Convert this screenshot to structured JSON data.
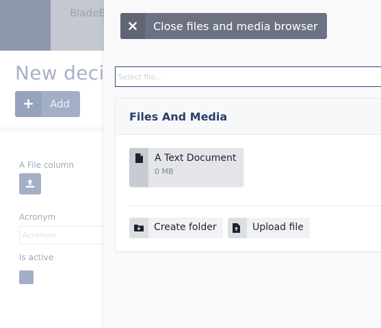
{
  "background_page": {
    "app_name": "BladeB",
    "title": "New deci",
    "add_button_label": "Add",
    "fields": {
      "file_column_label": "A File column",
      "acronym_label": "Acronym",
      "acronym_placeholder": "Acronym",
      "is_active_label": "Is active"
    }
  },
  "overlay": {
    "close_button_label": "Close files and media browser",
    "select_placeholder": "Select file...",
    "card_title": "Files And Media",
    "files": [
      {
        "name": "A Text Document",
        "size": "0 MB"
      }
    ],
    "actions": {
      "create_folder_label": "Create folder",
      "upload_file_label": "Upload file"
    }
  },
  "colors": {
    "accent": "#6c7281",
    "title_blue": "#2a3f6a",
    "muted_button": "#a3afc6"
  },
  "icons": {
    "close": "close-icon",
    "file": "file-icon",
    "folder_add": "folder-plus-icon",
    "upload": "upload-icon",
    "plus": "plus-icon"
  }
}
